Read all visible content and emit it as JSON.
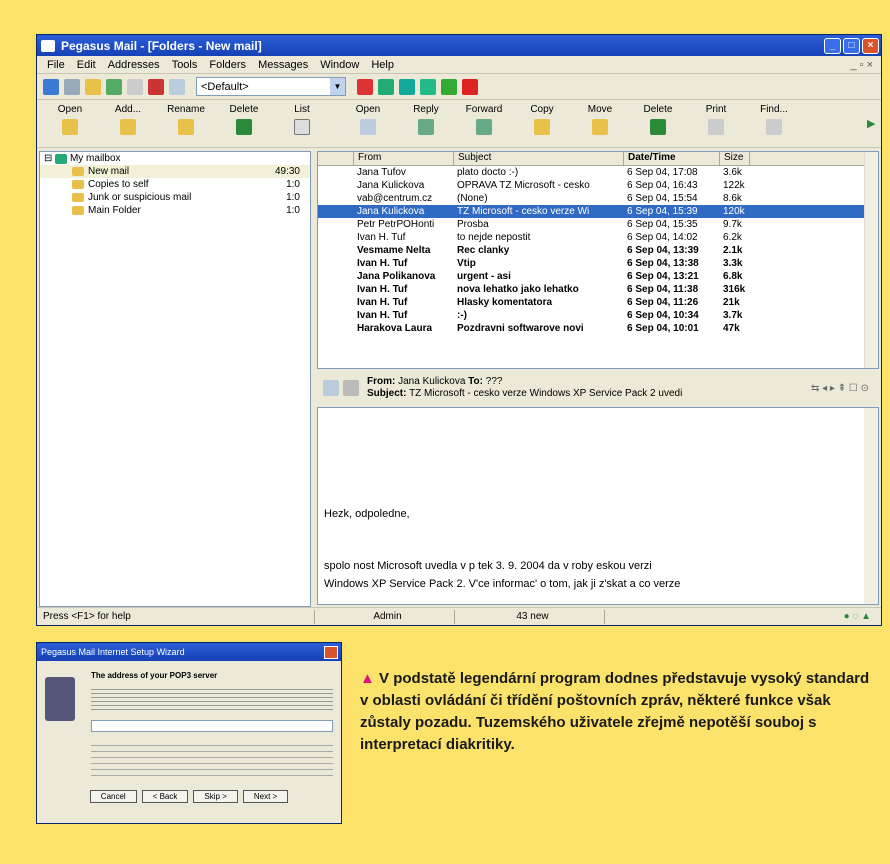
{
  "window": {
    "title": "Pegasus Mail - [Folders - New mail]"
  },
  "menu": [
    "File",
    "Edit",
    "Addresses",
    "Tools",
    "Folders",
    "Messages",
    "Window",
    "Help"
  ],
  "identity_select": "<Default>",
  "toolbar": [
    {
      "label": "Open"
    },
    {
      "label": "Add..."
    },
    {
      "label": "Rename"
    },
    {
      "label": "Delete"
    },
    {
      "label": "List"
    },
    {
      "label": "Open"
    },
    {
      "label": "Reply"
    },
    {
      "label": "Forward"
    },
    {
      "label": "Copy"
    },
    {
      "label": "Move"
    },
    {
      "label": "Delete"
    },
    {
      "label": "Print"
    },
    {
      "label": "Find..."
    }
  ],
  "folders": {
    "root": "My mailbox",
    "items": [
      {
        "name": "New mail",
        "count": "49:30"
      },
      {
        "name": "Copies to self",
        "count": "1:0"
      },
      {
        "name": "Junk or suspicious mail",
        "count": "1:0"
      },
      {
        "name": "Main Folder",
        "count": "1:0"
      }
    ]
  },
  "columns": [
    "From",
    "Subject",
    "Date/Time",
    "Size"
  ],
  "messages": [
    {
      "from": "Jana Tufov",
      "subject": "plato docto :-)",
      "date": "6 Sep 04, 17:08",
      "size": "3.6k",
      "bold": false,
      "sel": false
    },
    {
      "from": "Jana Kulickova",
      "subject": "OPRAVA TZ Microsoft - cesko",
      "date": "6 Sep 04, 16:43",
      "size": "122k",
      "bold": false,
      "sel": false
    },
    {
      "from": "vab@centrum.cz",
      "subject": "(None)",
      "date": "6 Sep 04, 15:54",
      "size": "8.6k",
      "bold": false,
      "sel": false
    },
    {
      "from": "Jana Kulickova",
      "subject": "TZ Microsoft - cesko verze Wi",
      "date": "6 Sep 04, 15:39",
      "size": "120k",
      "bold": false,
      "sel": true
    },
    {
      "from": "Petr PetrPOHonti",
      "subject": "Prosba",
      "date": "6 Sep 04, 15:35",
      "size": "9.7k",
      "bold": false,
      "sel": false
    },
    {
      "from": "Ivan H. Tuf",
      "subject": "to nejde nepostit",
      "date": "6 Sep 04, 14:02",
      "size": "6.2k",
      "bold": false,
      "sel": false
    },
    {
      "from": "Vesmame Nelta",
      "subject": "Rec clanky",
      "date": "6 Sep 04, 13:39",
      "size": "2.1k",
      "bold": true,
      "sel": false
    },
    {
      "from": "Ivan H. Tuf",
      "subject": "Vtip",
      "date": "6 Sep 04, 13:38",
      "size": "3.3k",
      "bold": true,
      "sel": false
    },
    {
      "from": "Jana Polikanova",
      "subject": "urgent - asi",
      "date": "6 Sep 04, 13:21",
      "size": "6.8k",
      "bold": true,
      "sel": false
    },
    {
      "from": "Ivan H. Tuf",
      "subject": "nova lehatko jako lehatko",
      "date": "6 Sep 04, 11:38",
      "size": "316k",
      "bold": true,
      "sel": false
    },
    {
      "from": "Ivan H. Tuf",
      "subject": "Hlasky komentatora",
      "date": "6 Sep 04, 11:26",
      "size": "21k",
      "bold": true,
      "sel": false
    },
    {
      "from": "Ivan H. Tuf",
      "subject": ":-)",
      "date": "6 Sep 04, 10:34",
      "size": "3.7k",
      "bold": true,
      "sel": false
    },
    {
      "from": "Harakova Laura",
      "subject": "Pozdravni softwarove novi",
      "date": "6 Sep 04, 10:01",
      "size": "47k",
      "bold": true,
      "sel": false
    }
  ],
  "preview": {
    "from_label": "From:",
    "from": "Jana Kulickova",
    "to_label": "To:",
    "to": "???",
    "subject_label": "Subject:",
    "subject": "TZ Microsoft - cesko verze Windows XP Service Pack 2 uvedi",
    "lines": [
      "Hezk, odpoledne,",
      "spolo nost Microsoft uvedla v p tek 3. 9. 2004 da v roby  eskou verzi",
      "Windows XP Service  Pack 2. V'ce informac' o tom, jak ji z'skat a co verze"
    ]
  },
  "status": {
    "help": "Press <F1> for help",
    "user": "Admin",
    "new": "43 new"
  },
  "dialog": {
    "title": "Pegasus Mail Internet Setup Wizard",
    "heading": "The address of your POP3 server",
    "buttons": [
      "Cancel",
      "< Back",
      "Skip >",
      "Next >"
    ]
  },
  "caption": "V podstatě legendární program dodnes představuje vysoký standard v oblasti ovládání či třídění poštovních zpráv, některé funkce však zůstaly pozadu. Tuzemského uživatele zřejmě nepotěší souboj s interpretací diakritiky."
}
